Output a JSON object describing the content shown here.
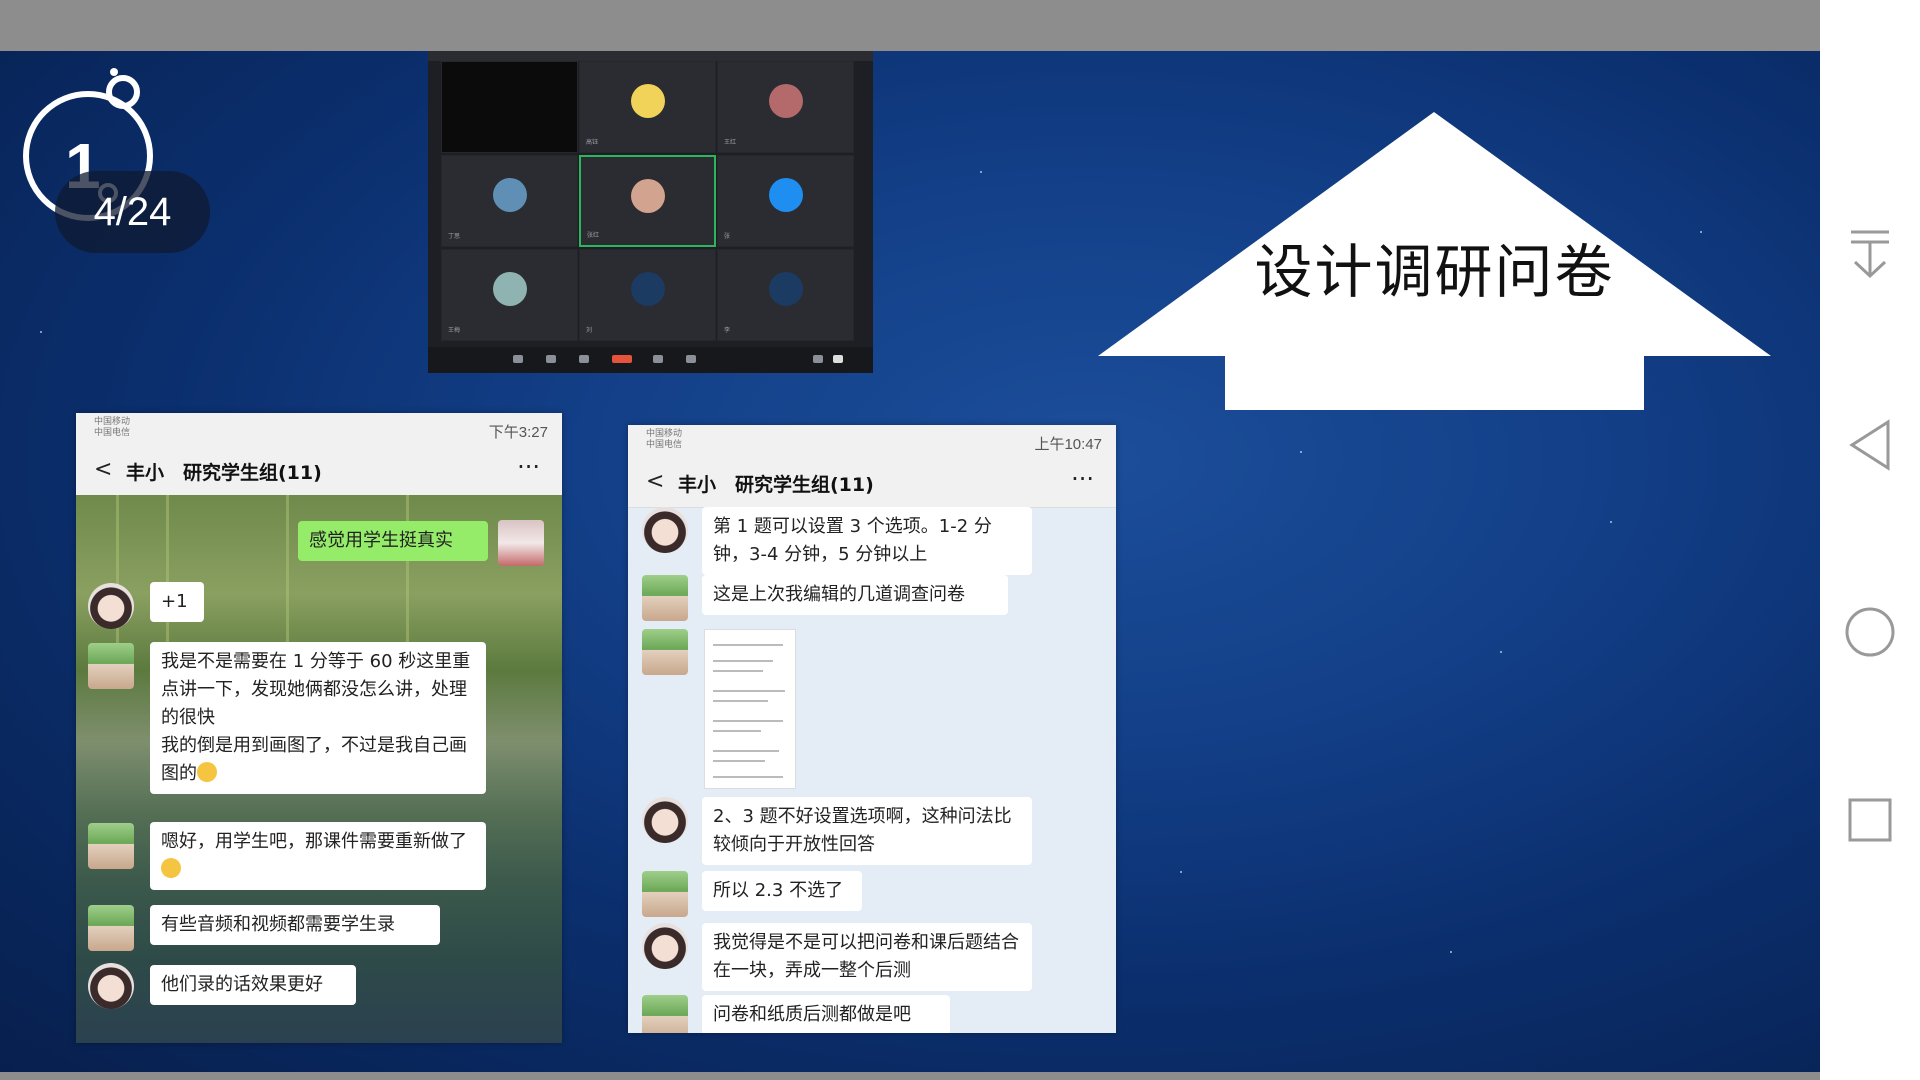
{
  "slide": {
    "page_indicator": "4/24",
    "logo_number": "1",
    "arrow_title": "设计调研问卷"
  },
  "meeting": {
    "tiles": [
      {
        "name": ""
      },
      {
        "name": "高钰"
      },
      {
        "name": "王红"
      },
      {
        "name": "丁思"
      },
      {
        "name": "张红"
      },
      {
        "name": "张"
      },
      {
        "name": "王梅"
      },
      {
        "name": "刘"
      },
      {
        "name": "李"
      }
    ]
  },
  "chat_left": {
    "status_left_1": "中国移动",
    "status_left_2": "中国电信",
    "status_time": "下午3:27",
    "title": "丰小　研究学生组(11)",
    "back": "<",
    "more": "···",
    "messages": [
      {
        "text": "感觉用学生挺真实",
        "side": "right"
      },
      {
        "text": "+1",
        "side": "left"
      },
      {
        "text": "我是不是需要在 1 分等于 60 秒这里重点讲一下，发现她俩都没怎么讲，处理的很快",
        "side": "left"
      },
      {
        "text": "我的倒是用到画图了，不过是我自己画图的",
        "side": "left"
      },
      {
        "text": "嗯好，用学生吧，那课件需要重新做了",
        "side": "left"
      },
      {
        "text": "有些音频和视频都需要学生录",
        "side": "left"
      },
      {
        "text": "他们录的话效果更好",
        "side": "left"
      }
    ]
  },
  "chat_right": {
    "status_left_1": "中国移动",
    "status_left_2": "中国电信",
    "status_time": "上午10:47",
    "title": "丰小　研究学生组(11)",
    "back": "<",
    "more": "···",
    "messages": [
      {
        "text": "第 1 题可以设置 3 个选项。1-2 分钟，3-4 分钟，5 分钟以上"
      },
      {
        "text": "这是上次我编辑的几道调查问卷"
      },
      {
        "text": "2、3 题不好设置选项啊，这种问法比较倾向于开放性回答"
      },
      {
        "text": "所以 2.3 不选了"
      },
      {
        "text": "我觉得是不是可以把问卷和课后题结合在一块，弄成一整个后测"
      },
      {
        "text": "问卷和纸质后测都做是吧"
      }
    ]
  },
  "navbar": {
    "icons": [
      "download-icon",
      "back-triangle-icon",
      "home-circle-icon",
      "recent-square-icon"
    ]
  }
}
